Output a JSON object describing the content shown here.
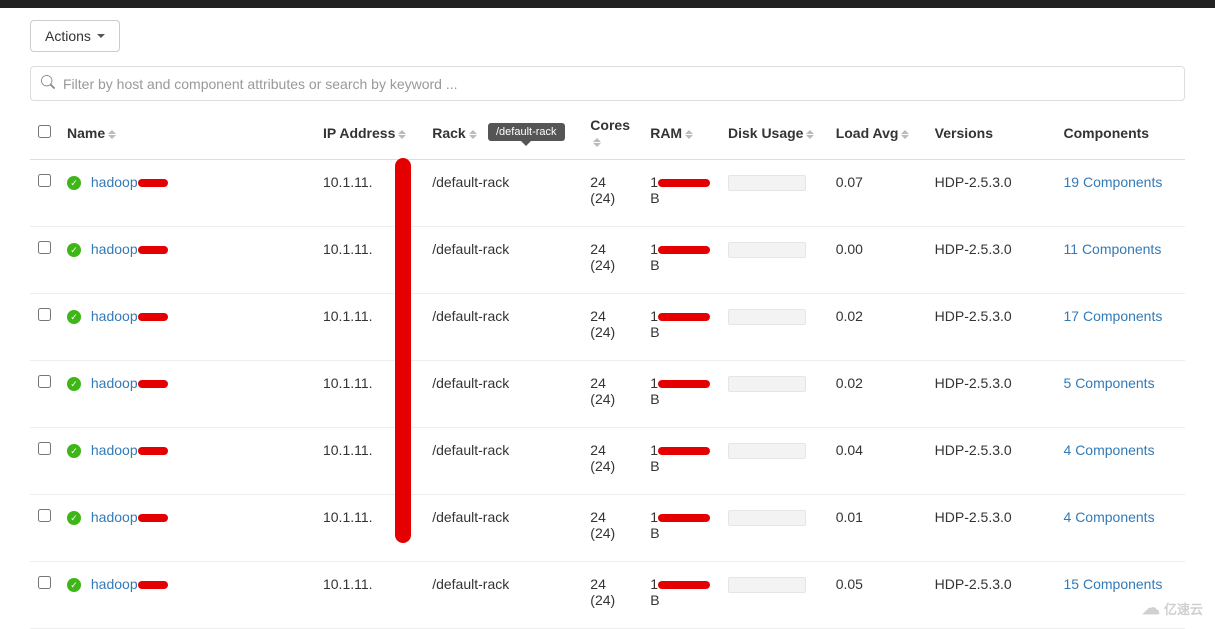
{
  "actions": {
    "label": "Actions"
  },
  "filter": {
    "placeholder": "Filter by host and component attributes or search by keyword ..."
  },
  "tooltip": {
    "text": "/default-rack"
  },
  "columns": {
    "name": "Name",
    "ip": "IP Address",
    "rack": "Rack",
    "cores": "Cores",
    "ram": "RAM",
    "disk": "Disk Usage",
    "load": "Load Avg",
    "versions": "Versions",
    "components": "Components"
  },
  "rows": [
    {
      "name": "hadoop",
      "ip": "10.1.11.",
      "rack": "/default-rack",
      "cores": "24",
      "cores_sub": "(24)",
      "ram_prefix": "1",
      "ram_suffix": "B",
      "load": "0.07",
      "version": "HDP-2.5.3.0",
      "components": "19 Components"
    },
    {
      "name": "hadoop",
      "ip": "10.1.11.",
      "rack": "/default-rack",
      "cores": "24",
      "cores_sub": "(24)",
      "ram_prefix": "1",
      "ram_suffix": "B",
      "load": "0.00",
      "version": "HDP-2.5.3.0",
      "components": "11 Components"
    },
    {
      "name": "hadoop",
      "ip": "10.1.11.",
      "rack": "/default-rack",
      "cores": "24",
      "cores_sub": "(24)",
      "ram_prefix": "1",
      "ram_suffix": "B",
      "load": "0.02",
      "version": "HDP-2.5.3.0",
      "components": "17 Components"
    },
    {
      "name": "hadoop",
      "ip": "10.1.11.",
      "rack": "/default-rack",
      "cores": "24",
      "cores_sub": "(24)",
      "ram_prefix": "1",
      "ram_suffix": "B",
      "load": "0.02",
      "version": "HDP-2.5.3.0",
      "components": "5 Components"
    },
    {
      "name": "hadoop",
      "ip": "10.1.11.",
      "rack": "/default-rack",
      "cores": "24",
      "cores_sub": "(24)",
      "ram_prefix": "1",
      "ram_suffix": "B",
      "load": "0.04",
      "version": "HDP-2.5.3.0",
      "components": "4 Components"
    },
    {
      "name": "hadoop",
      "ip": "10.1.11.",
      "rack": "/default-rack",
      "cores": "24",
      "cores_sub": "(24)",
      "ram_prefix": "1",
      "ram_suffix": "B",
      "load": "0.01",
      "version": "HDP-2.5.3.0",
      "components": "4 Components"
    },
    {
      "name": "hadoop",
      "ip": "10.1.11.",
      "rack": "/default-rack",
      "cores": "24",
      "cores_sub": "(24)",
      "ram_prefix": "1",
      "ram_suffix": "B",
      "load": "0.05",
      "version": "HDP-2.5.3.0",
      "components": "15 Components"
    }
  ],
  "watermark": {
    "text": "亿速云"
  }
}
